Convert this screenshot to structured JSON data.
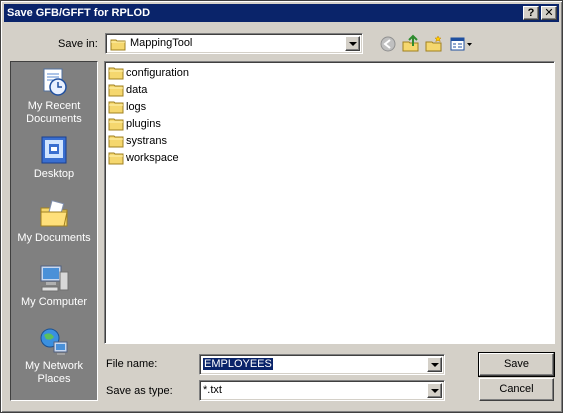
{
  "window": {
    "title": "Save GFB/GFFT for RPLOD"
  },
  "titlebar_buttons": {
    "help": "?",
    "close": "✕"
  },
  "save_in": {
    "label": "Save in:",
    "value": "MappingTool"
  },
  "places": [
    {
      "label": "My Recent Documents",
      "icon": "recent-documents-icon"
    },
    {
      "label": "Desktop",
      "icon": "desktop-icon"
    },
    {
      "label": "My Documents",
      "icon": "my-documents-icon"
    },
    {
      "label": "My Computer",
      "icon": "my-computer-icon"
    },
    {
      "label": "My Network Places",
      "icon": "network-places-icon"
    }
  ],
  "files": [
    {
      "name": "configuration",
      "type": "folder"
    },
    {
      "name": "data",
      "type": "folder"
    },
    {
      "name": "logs",
      "type": "folder"
    },
    {
      "name": "plugins",
      "type": "folder"
    },
    {
      "name": "systrans",
      "type": "folder"
    },
    {
      "name": "workspace",
      "type": "folder"
    }
  ],
  "file_name": {
    "label": "File name:",
    "value": "EMPLOYEES"
  },
  "save_as_type": {
    "label": "Save as type:",
    "value": "*.txt"
  },
  "buttons": {
    "save": "Save",
    "cancel": "Cancel"
  },
  "colors": {
    "titlebar": "#0a246a",
    "dialog_bg": "#d4d0c8",
    "places_bg": "#808080",
    "folder": "#f5d76e"
  }
}
